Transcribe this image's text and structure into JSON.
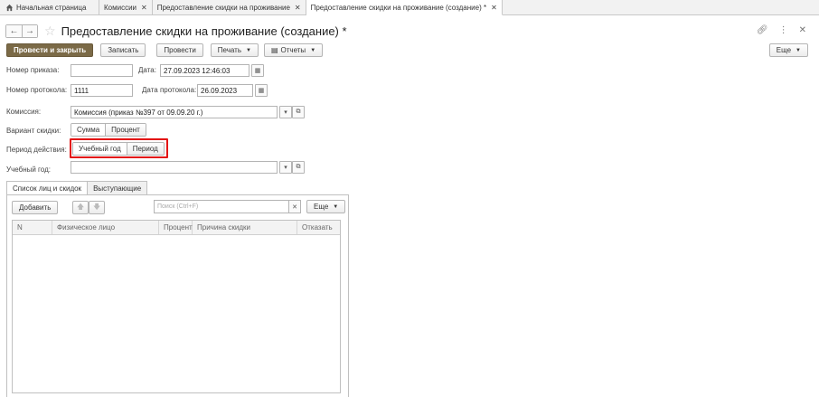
{
  "tabs": [
    {
      "label": "Начальная страница",
      "closable": false
    },
    {
      "label": "Комиссии",
      "closable": true
    },
    {
      "label": "Предоставление скидки на проживание",
      "closable": true
    },
    {
      "label": "Предоставление скидки на проживание (создание) *",
      "closable": true
    }
  ],
  "header": {
    "title": "Предоставление скидки на проживание (создание) *",
    "link_icon": "link-icon",
    "menu_icon": "more-vertical-icon",
    "close_icon": "close-icon"
  },
  "toolbar": {
    "post_close": "Провести и закрыть",
    "save": "Записать",
    "post": "Провести",
    "print": "Печать",
    "reports": "Отчеты",
    "more": "Еще"
  },
  "form": {
    "order_number_label": "Номер приказа:",
    "order_number_value": "",
    "date_label": "Дата:",
    "date_value": "27.09.2023 12:46:03",
    "protocol_number_label": "Номер протокола:",
    "protocol_number_value": "1111",
    "protocol_date_label": "Дата протокола:",
    "protocol_date_value": "26.09.2023",
    "commission_label": "Комиссия:",
    "commission_value": "Комиссия (приказ №397 от 09.09.20 г.)",
    "discount_variant_label": "Вариант скидки:",
    "discount_variant_options": [
      "Сумма",
      "Процент"
    ],
    "period_label": "Период действия:",
    "period_options": [
      "Учебный год",
      "Период"
    ],
    "academic_year_label": "Учебный год:",
    "academic_year_value": ""
  },
  "inner_tabs": [
    "Список лиц и скидок",
    "Выступающие"
  ],
  "list": {
    "add_button": "Добавить",
    "search_placeholder": "Поиск (Ctrl+F)",
    "more": "Еще",
    "columns": [
      "N",
      "Физическое лицо",
      "Процент",
      "Причина скидки",
      "Отказать"
    ]
  },
  "colors": {
    "primary_button": "#7b6a47",
    "highlight_box": "#e31414"
  }
}
